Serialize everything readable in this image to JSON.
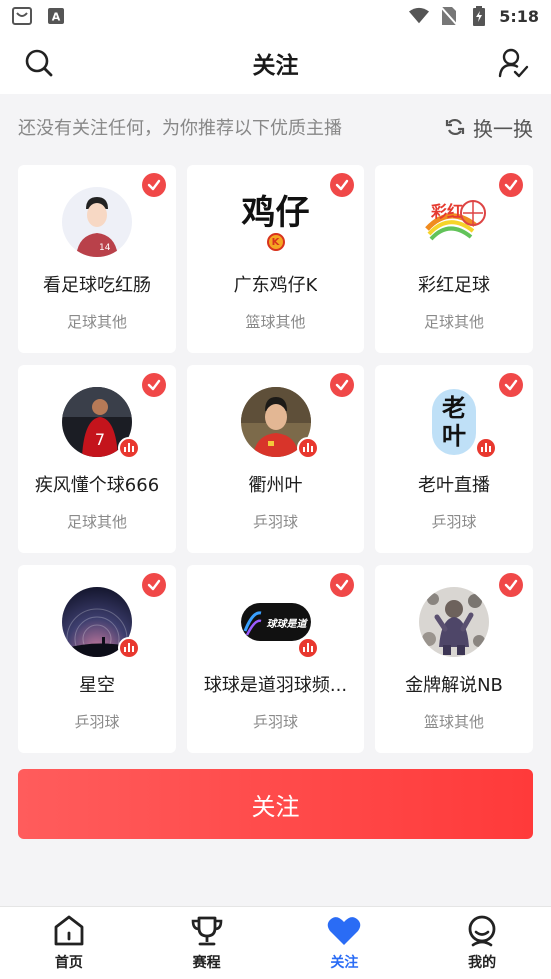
{
  "status_bar": {
    "time": "5:18",
    "icons": [
      "notification-icon",
      "keyboard-a-icon",
      "wifi-icon",
      "no-sim-icon",
      "battery-icon"
    ]
  },
  "header": {
    "title": "关注",
    "left_icon": "search-icon",
    "right_icon": "user-check-icon"
  },
  "recommend": {
    "text": "还没有关注任何，为你推荐以下优质主播",
    "refresh_label": "换一换",
    "refresh_icon": "refresh-icon"
  },
  "streamers": [
    {
      "name": "看足球吃红肠",
      "category": "足球其他",
      "avatar_text": "",
      "live": false,
      "checked": true
    },
    {
      "name": "广东鸡仔K",
      "category": "篮球其他",
      "avatar_text": "鸡仔",
      "avatar_badge": "K",
      "live": false,
      "checked": true
    },
    {
      "name": "彩红足球",
      "category": "足球其他",
      "avatar_text": "",
      "live": false,
      "checked": true
    },
    {
      "name": "疾风懂个球666",
      "category": "足球其他",
      "avatar_text": "",
      "live": true,
      "checked": true
    },
    {
      "name": "衢州叶",
      "category": "乒羽球",
      "avatar_text": "",
      "live": true,
      "checked": true
    },
    {
      "name": "老叶直播",
      "category": "乒羽球",
      "avatar_text": "老叶",
      "live": true,
      "checked": true
    },
    {
      "name": "星空",
      "category": "乒羽球",
      "avatar_text": "",
      "live": true,
      "checked": true
    },
    {
      "name": "球球是道羽球频...",
      "category": "乒羽球",
      "avatar_text": "球球是道",
      "live": true,
      "checked": true
    },
    {
      "name": "金牌解说NB",
      "category": "篮球其他",
      "avatar_text": "",
      "live": false,
      "checked": true
    }
  ],
  "follow_button": {
    "label": "关注"
  },
  "bottom_nav": [
    {
      "label": "首页",
      "icon": "home-icon",
      "active": false
    },
    {
      "label": "赛程",
      "icon": "trophy-icon",
      "active": false
    },
    {
      "label": "关注",
      "icon": "heart-icon",
      "active": true
    },
    {
      "label": "我的",
      "icon": "profile-icon",
      "active": false
    }
  ],
  "colors": {
    "accent_red": "#f04848",
    "active_blue": "#2a6cf5",
    "background": "#f4f4f6"
  }
}
